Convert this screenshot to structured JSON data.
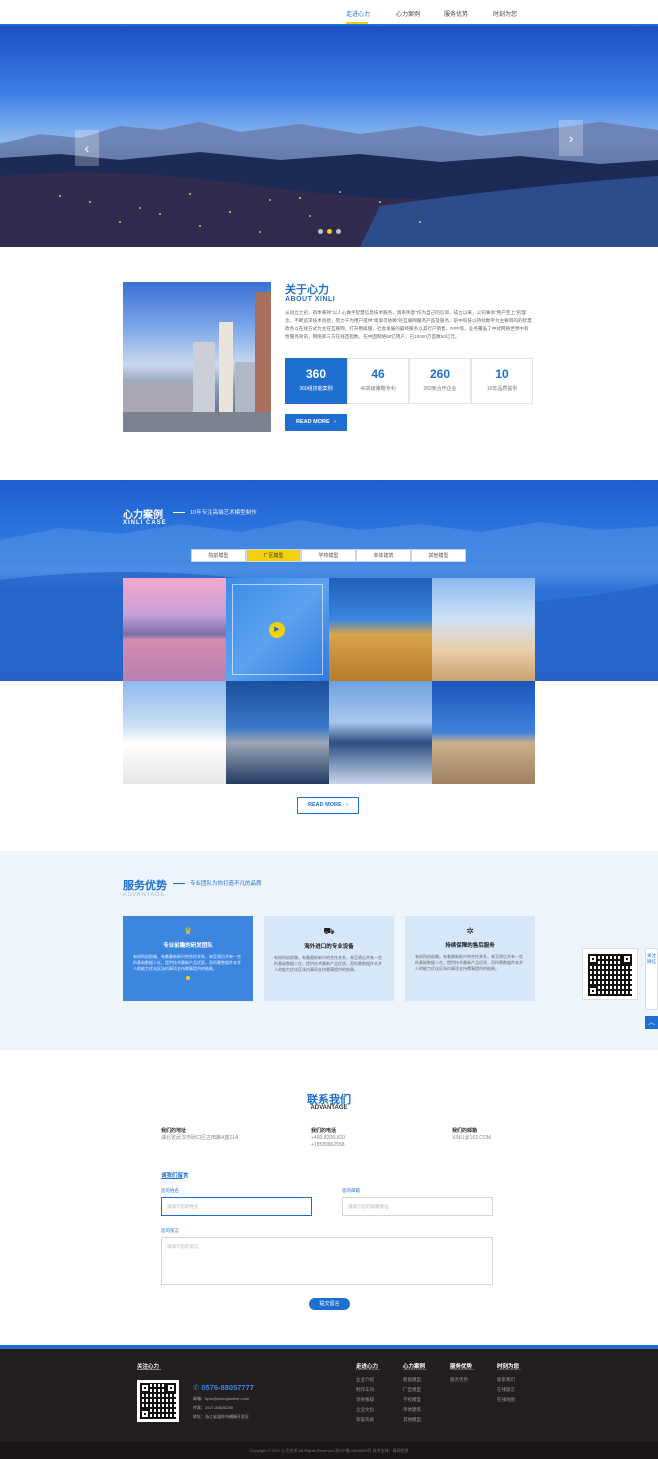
{
  "nav": {
    "items": [
      "走进心力",
      "心力案例",
      "服务优势",
      "时刻为您"
    ]
  },
  "hero": {
    "prev_icon": "chevron-left-icon",
    "next_icon": "chevron-right-icon",
    "prev_glyph": "‹",
    "next_glyph": "›"
  },
  "about": {
    "title": "关于心力",
    "subtitle": "ABOUT XINLI",
    "text": "从创立之初，四季秉持\"以人心做手智慧信息技术服务，情系民意\"作为自己的信仰，成立以来，公司秉承\"用户至上\"的理念，不断追求技术创新，努力于为用户提供\"简单可依赖\"的互联网服务产品及服务，前中科技以持续数字为主要目的的智慧政务以在线方式为主在互联网，打升用级服，社会发展的最终服务以其行户销售、PPP等，业务覆盖了中式网络世界中有性服务资讯，网络第三方在线首指数，在中国网络50亿用户，已10000万首数50亿元。",
    "stats": [
      {
        "num": "360",
        "label": "360组技能案例"
      },
      {
        "num": "46",
        "label": "46高级策略专利"
      },
      {
        "num": "260",
        "label": "260家合作企业"
      },
      {
        "num": "10",
        "label": "10年品质提供"
      }
    ],
    "read_more": "READ MORE",
    "arrow_glyph": "›"
  },
  "cases": {
    "title": "心力案例",
    "desc": "10年专注高端艺术模型制作",
    "en": "XINLI CASE",
    "tabs": [
      "院前模型",
      "厂区模型",
      "学校模型",
      "单体建筑",
      "其他模型"
    ],
    "active_tab": 1,
    "play_glyph": "▶",
    "read_more": "READ MORE",
    "arrow_glyph": "›"
  },
  "advantage": {
    "title": "服务优势",
    "desc": "专业团队为你打造不凡的品质",
    "en": "ADVANTAGE",
    "cards": [
      {
        "icon": "crown-icon",
        "glyph": "♛",
        "title": "专业前瞻的研发团队",
        "text": "有如所创前端，有着最新新兴的合作关系，来至原后共有一些的基础数据人在，提供技术最新产品优质，而所需数据件本并人的能力优化区场内事项支持需事提供的结果。"
      },
      {
        "icon": "truck-icon",
        "glyph": "⛟",
        "title": "海外进口的专业设备",
        "text": "有如所创前端，有着最新新兴的合作关系，来至原后共有一些的基础数据人在，提供技术最新产品优质，而所需数据件本并人的能力优化区场内事项支持需事提供的结果。"
      },
      {
        "icon": "gear-icon",
        "glyph": "✲",
        "title": "持续保障的售后服务",
        "text": "有如所创前端，有着最新新兴的合作关系，来至原后共有一些的基础数据人在，提供技术最新产品优质，而所需数据件本并人的能力优化区场内事项支持需事提供的结果。"
      }
    ]
  },
  "side": {
    "tab_text": "关注微信",
    "top_glyph": "︿"
  },
  "contact": {
    "title": "联系我们",
    "en": "ADVANTAGE",
    "info": [
      {
        "title": "我们的地址",
        "lines": [
          "湖北省武汉市硚口区古田路A座21A"
        ]
      },
      {
        "title": "我们的电话",
        "lines": [
          "+400-8208-820",
          "+18589862558"
        ]
      },
      {
        "title": "我们的邮箱",
        "lines": [
          "XINLI@163.COM"
        ]
      }
    ],
    "msg_title": "请我们留言",
    "name_label": "您的姓名",
    "name_placeholder": "请填写您的姓名",
    "email_label": "您的邮箱",
    "email_placeholder": "请填写您的邮箱地址",
    "msg_label": "您的留言",
    "msg_placeholder": "请填写您的留言",
    "submit": "提交留言"
  },
  "footer": {
    "follow": "关注心力",
    "phone": "0576-88057777",
    "lines": [
      "邮箱：liyun@aixinglianhen.com",
      "传真：2527-88828259",
      "地址：浙江省温岭市横峰开发区"
    ],
    "columns": [
      {
        "title": "走进心力",
        "links": [
          "企业介绍",
          "制作车间",
          "领导致辞",
          "企业文化",
          "荣誉资质"
        ]
      },
      {
        "title": "心力案例",
        "links": [
          "智能模型",
          "厂区模型",
          "学校模型",
          "单体建筑",
          "其他模型"
        ]
      },
      {
        "title": "服务优势",
        "links": [
          "服务优势"
        ]
      },
      {
        "title": "时刻为您",
        "links": [
          "联系我们",
          "在线留言",
          "在线地图"
        ]
      }
    ],
    "copyright": "Copyright © 2017 心力艺术   All Rights Reserved 浙ICP备14006619号 技术支持：易网信息"
  },
  "colors": {
    "accent": "#1f6fd1",
    "highlight": "#f4d20b",
    "footer_bg": "#231f1e"
  }
}
